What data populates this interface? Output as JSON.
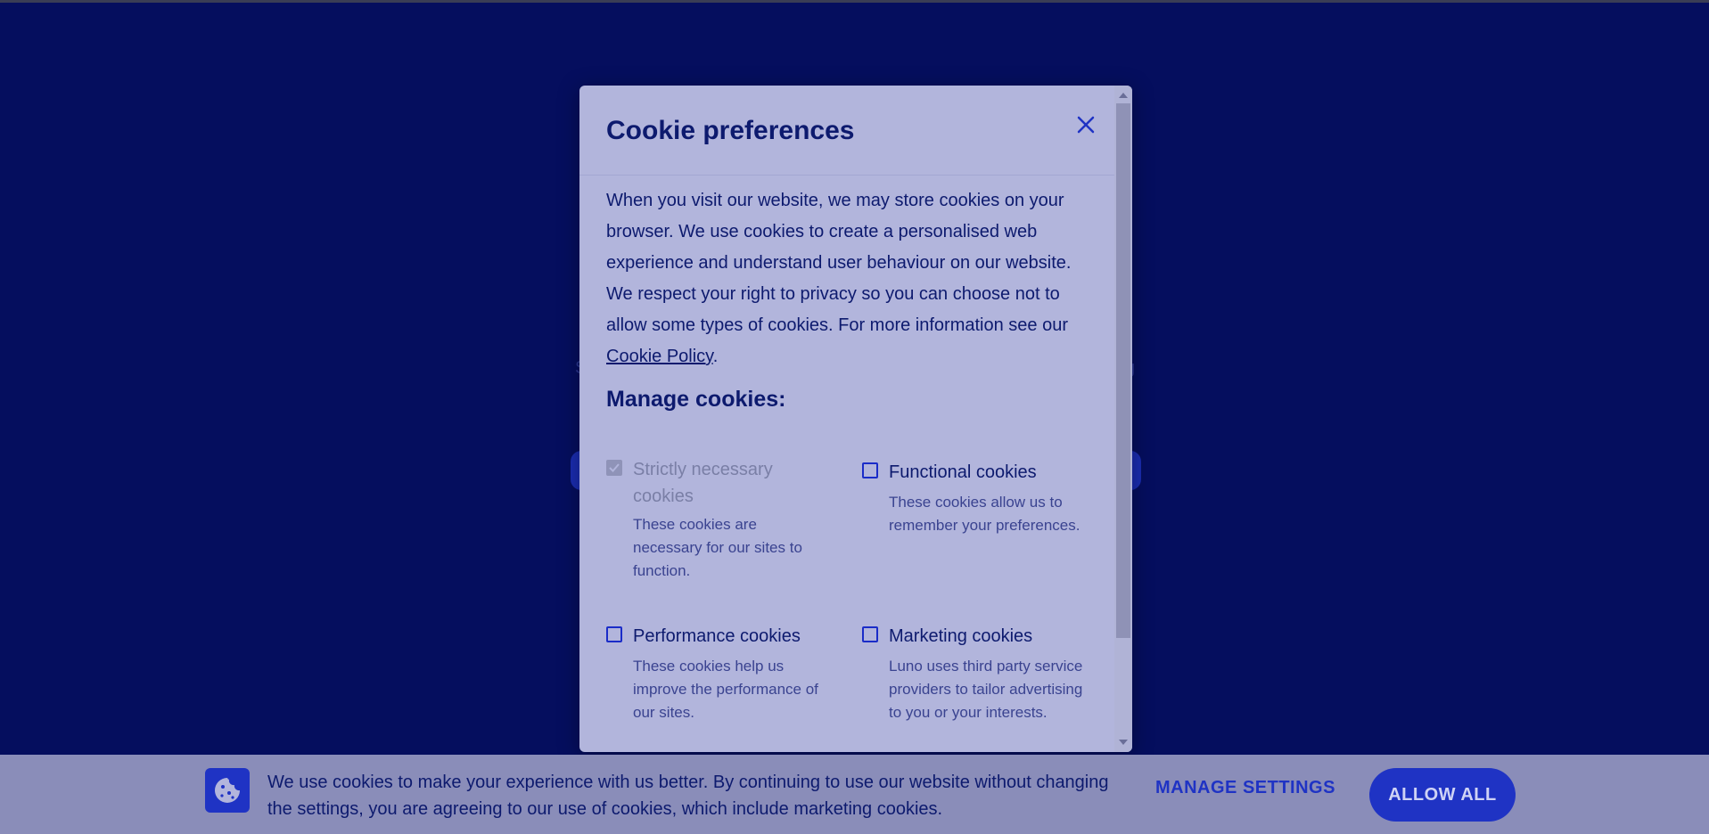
{
  "modal": {
    "title": "Cookie preferences",
    "intro_text": "When you visit our website, we may store cookies on your browser. We use cookies to create a personalised web experience and understand user behaviour on our website. We respect your right to privacy so you can choose not to allow some types of cookies. For more information see our ",
    "policy_link": "Cookie Policy",
    "intro_end": ".",
    "manage_title": "Manage cookies:",
    "options": [
      {
        "label": "Strictly necessary cookies",
        "description": "These cookies are necessary for our sites to function.",
        "checked": true,
        "disabled": true
      },
      {
        "label": "Functional cookies",
        "description": "These cookies allow us to remember your preferences.",
        "checked": false,
        "disabled": false
      },
      {
        "label": "Performance cookies",
        "description": "These cookies help us improve the performance of our sites.",
        "checked": false,
        "disabled": false
      },
      {
        "label": "Marketing cookies",
        "description": "Luno uses third party service providers to tailor advertising to you or your interests.",
        "checked": false,
        "disabled": false
      }
    ]
  },
  "banner": {
    "text": "We use cookies to make your experience with us better. By continuing to use our website without changing the settings, you are agreeing to our use of cookies, which include marketing cookies.",
    "manage_settings_label": "MANAGE SETTINGS",
    "allow_all_label": "ALLOW ALL"
  },
  "colors": {
    "page_background": "#050e5e",
    "modal_background": "#b2b5dc",
    "text_primary": "#0d1a6e",
    "accent": "#1f33c4",
    "banner_background": "#8a8db9"
  },
  "icons": {
    "close": "close-icon",
    "banner": "cookie-icon",
    "checkbox_checked": "checkmark-icon"
  }
}
